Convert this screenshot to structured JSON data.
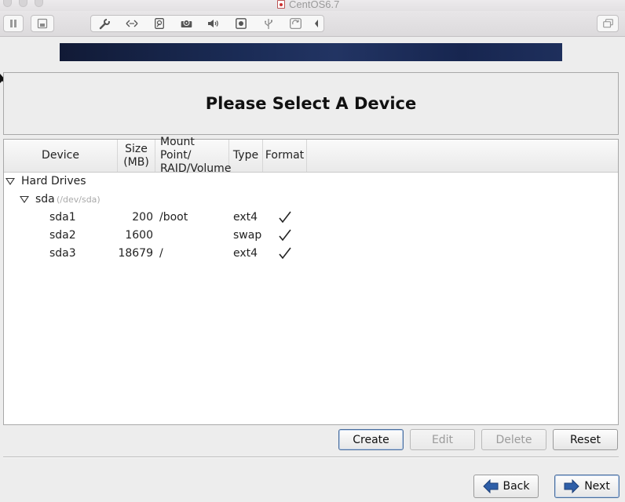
{
  "window": {
    "title": "CentOS6.7"
  },
  "toolbar": {
    "icons": [
      "pause-icon",
      "snapshot-icon",
      "wrench-icon",
      "network-arrows-icon",
      "harddisk-icon",
      "optical-disc-icon",
      "speaker-icon",
      "camera-icon",
      "usb-icon",
      "refresh-icon",
      "chevron-left-icon",
      "window-restore-icon"
    ]
  },
  "header": {
    "title": "Please Select A Device"
  },
  "table": {
    "columns": {
      "device": "Device",
      "size_line1": "Size",
      "size_line2": "(MB)",
      "mount_line1": "Mount Point/",
      "mount_line2": "RAID/Volume",
      "type": "Type",
      "format": "Format"
    },
    "group": {
      "label": "Hard Drives"
    },
    "disk": {
      "name": "sda",
      "path": "(/dev/sda)"
    },
    "partitions": [
      {
        "device": "sda1",
        "size": "200",
        "mount": "/boot",
        "type": "ext4",
        "format": true
      },
      {
        "device": "sda2",
        "size": "1600",
        "mount": "",
        "type": "swap",
        "format": true
      },
      {
        "device": "sda3",
        "size": "18679",
        "mount": "/",
        "type": "ext4",
        "format": true
      }
    ]
  },
  "actions": {
    "create": "Create",
    "edit": "Edit",
    "delete": "Delete",
    "reset": "Reset"
  },
  "nav": {
    "back": "Back",
    "next": "Next"
  },
  "colors": {
    "banner_dark": "#111a36",
    "banner_light": "#223463",
    "nav_arrow": "#2f5fa8"
  }
}
